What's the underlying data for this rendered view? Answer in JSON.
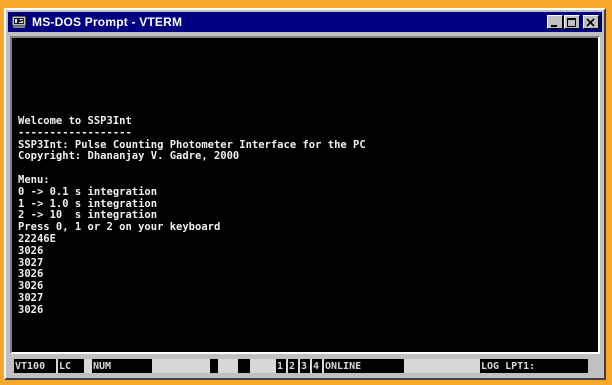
{
  "window": {
    "title": "MS-DOS Prompt - VTERM"
  },
  "terminal": {
    "lines": [
      "Welcome to SSP3Int",
      "------------------",
      "SSP3Int: Pulse Counting Photometer Interface for the PC",
      "Copyright: Dhananjay V. Gadre, 2000",
      "",
      "Menu:",
      "0 -> 0.1 s integration",
      "1 -> 1.0 s integration",
      "2 -> 10  s integration",
      "Press 0, 1 or 2 on your keyboard",
      "22246E",
      "3026",
      "3027",
      "3026",
      "3026",
      "3027",
      "3026"
    ]
  },
  "statusbar": {
    "emulation": "VT100",
    "lc": "LC",
    "num": "NUM",
    "digit1": "1",
    "digit2": "2",
    "digit3": "3",
    "digit4": "4",
    "online": "ONLINE",
    "log": "LOG LPT1:"
  },
  "colors": {
    "background": "#f7a72a",
    "titlebar": "#000080",
    "terminal_bg": "#000000",
    "terminal_fg": "#f0f0f0"
  }
}
